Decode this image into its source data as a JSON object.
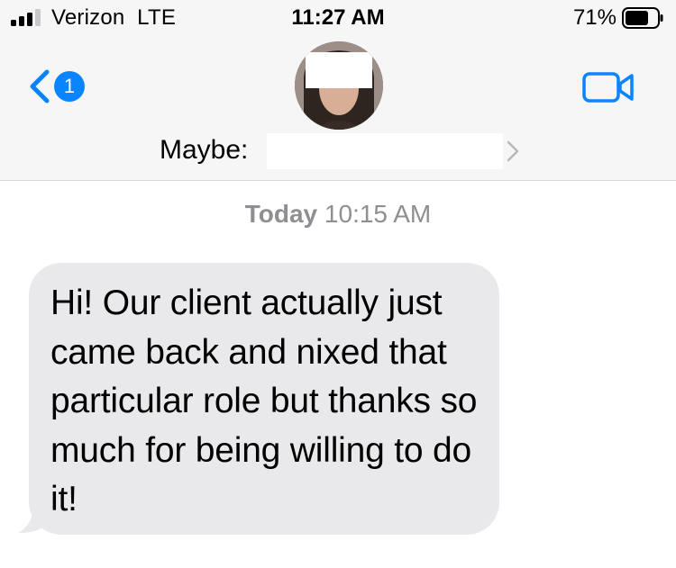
{
  "status_bar": {
    "carrier": "Verizon  LTE",
    "time": "11:27 AM",
    "battery_percent": "71%",
    "battery_level": 0.71,
    "signal_bars": 3
  },
  "header": {
    "back_badge": "1",
    "contact_prefix": "Maybe:",
    "accent_color": "#0a84ff"
  },
  "conversation": {
    "timestamp_day": "Today",
    "timestamp_time": "10:15 AM",
    "messages": [
      {
        "direction": "incoming",
        "text": "Hi! Our client actually just came back and nixed that particular role but thanks so much for being willing to do it!"
      }
    ]
  },
  "icons": {
    "back": "chevron-left-icon",
    "video": "video-camera-icon",
    "contact_details": "chevron-right-icon"
  }
}
